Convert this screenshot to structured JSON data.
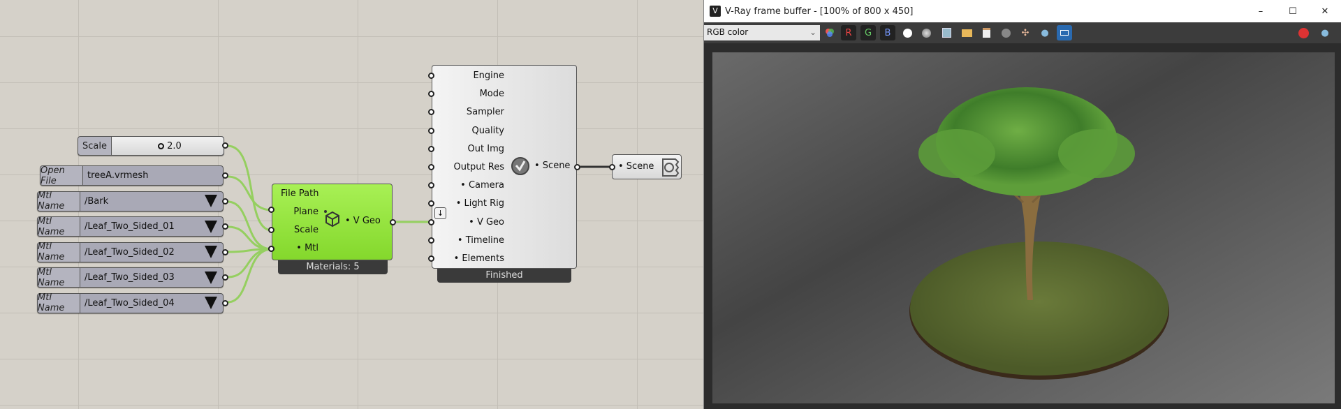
{
  "canvas": {
    "slider": {
      "label": "Scale",
      "value": "2.0"
    },
    "params": [
      {
        "label": "Open File",
        "value": "treeA.vrmesh",
        "dropdown": false
      },
      {
        "label": "Mtl Name",
        "value": "/Bark",
        "dropdown": true
      },
      {
        "label": "Mtl Name",
        "value": "/Leaf_Two_Sided_01",
        "dropdown": true
      },
      {
        "label": "Mtl Name",
        "value": "/Leaf_Two_Sided_02",
        "dropdown": true
      },
      {
        "label": "Mtl Name",
        "value": "/Leaf_Two_Sided_03",
        "dropdown": true
      },
      {
        "label": "Mtl Name",
        "value": "/Leaf_Two_Sided_04",
        "dropdown": true
      }
    ],
    "mesh_component": {
      "inputs": [
        "File Path",
        "Plane",
        "Scale",
        "• Mtl"
      ],
      "output": "• V Geo",
      "footer": "Materials: 5",
      "color": "#8fe23a"
    },
    "render_component": {
      "inputs": [
        "Engine",
        "Mode",
        "Sampler",
        "Quality",
        "Out Img",
        "Output Res",
        "• Camera",
        "• Light Rig",
        "• V Geo",
        "• Timeline",
        "• Elements"
      ],
      "output": "• Scene",
      "footer": "Finished"
    },
    "scene_param": {
      "label": "• Scene"
    }
  },
  "vfb": {
    "title": "V-Ray frame buffer - [100% of 800 x 450]",
    "channel": "RGB color",
    "buttons": {
      "r": "R",
      "g": "G",
      "b": "B"
    },
    "icons": [
      "color-correction-icon",
      "r-channel",
      "g-channel",
      "b-channel",
      "white-circle-icon",
      "gray-circle-icon",
      "save-icon",
      "open-folder-icon",
      "clipboard-icon",
      "clear-icon",
      "region-icon",
      "render-teapot-icon",
      "lens-effects-icon",
      "stop-icon",
      "teapot-icon"
    ]
  }
}
